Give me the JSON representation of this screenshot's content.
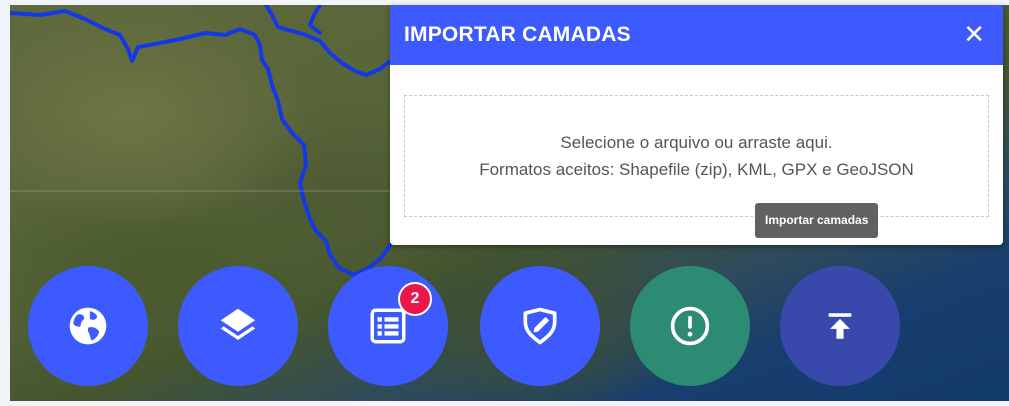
{
  "panel": {
    "title": "IMPORTAR CAMADAS",
    "close_glyph": "✕",
    "dropzone_line1": "Selecione o arquivo ou arraste aqui.",
    "dropzone_line2": "Formatos aceitos: Shapefile (zip), KML, GPX e GeoJSON"
  },
  "tooltip": "Importar camadas",
  "toolbar": {
    "buttons": [
      {
        "icon": "globe-icon",
        "color": "#3d5afe"
      },
      {
        "icon": "layers-icon",
        "color": "#3d5afe"
      },
      {
        "icon": "list-icon",
        "color": "#3d5afe",
        "badge": "2"
      },
      {
        "icon": "draw-shape-icon",
        "color": "#3d5afe"
      },
      {
        "icon": "alert-icon",
        "color": "#2e8b73"
      },
      {
        "icon": "upload-icon",
        "color": "#3949ab"
      }
    ]
  },
  "colors": {
    "header": "#3d5afe",
    "river": "#1238e8",
    "badge": "#e8194a"
  }
}
